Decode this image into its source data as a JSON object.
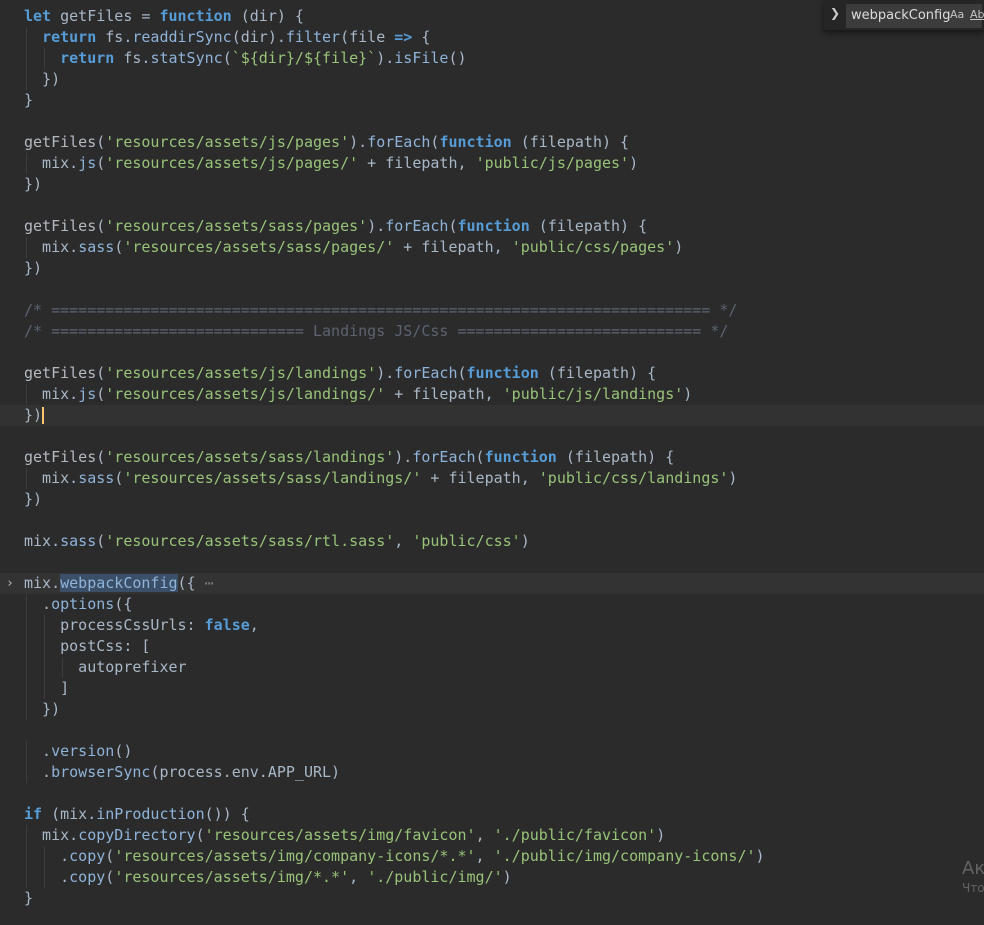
{
  "editor": {
    "lines": [
      "let getFiles = function (dir) {",
      "  return fs.readdirSync(dir).filter(file => {",
      "    return fs.statSync(`${dir}/${file}`).isFile()",
      "  })",
      "}",
      "",
      "getFiles('resources/assets/js/pages').forEach(function (filepath) {",
      "  mix.js('resources/assets/js/pages/' + filepath, 'public/js/pages')",
      "})",
      "",
      "getFiles('resources/assets/sass/pages').forEach(function (filepath) {",
      "  mix.sass('resources/assets/sass/pages/' + filepath, 'public/css/pages')",
      "})",
      "",
      "/* ========================================================================= */",
      "/* ============================ Landings JS/Css =========================== */",
      "",
      "getFiles('resources/assets/js/landings').forEach(function (filepath) {",
      "  mix.js('resources/assets/js/landings/' + filepath, 'public/js/landings')",
      "})",
      "",
      "getFiles('resources/assets/sass/landings').forEach(function (filepath) {",
      "  mix.sass('resources/assets/sass/landings/' + filepath, 'public/css/landings')",
      "})",
      "",
      "mix.sass('resources/assets/sass/rtl.sass', 'public/css')",
      "",
      "mix.webpackConfig({ ⋯",
      "  .options({",
      "    processCssUrls: false,",
      "    postCss: [",
      "      autoprefixer",
      "    ]",
      "  })",
      "",
      "  .version()",
      "  .browserSync(process.env.APP_URL)",
      "",
      "if (mix.inProduction()) {",
      "  mix.copyDirectory('resources/assets/img/favicon', './public/favicon')",
      "    .copy('resources/assets/img/company-icons/*.*', './public/img/company-icons/')",
      "    .copy('resources/assets/img/*.*', './public/img/')",
      "}"
    ]
  },
  "find_widget": {
    "query": "webpackConfig",
    "match_case_label": "Aa",
    "whole_word_label": "Ab|"
  },
  "watermark": {
    "line1": "Ак",
    "line2": "Что"
  }
}
